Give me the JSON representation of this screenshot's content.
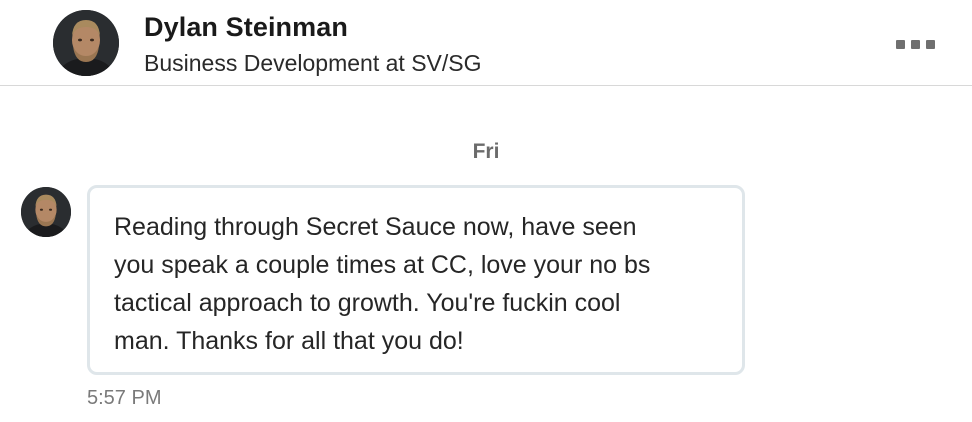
{
  "conversation": {
    "contact": {
      "name": "Dylan Steinman",
      "headline": "Business Development at SV/SG"
    },
    "more_menu_icon": "more-horizontal-icon",
    "day_label": "Fri",
    "messages": [
      {
        "lines": [
          "Reading through Secret Sauce now, have seen",
          "you speak a couple times at CC, love your no bs",
          "tactical approach to growth. You're fuckin cool",
          "man. Thanks for all that you do!"
        ],
        "time": "5:57 PM"
      }
    ]
  },
  "colors": {
    "bubble_border": "#dfe6ea",
    "divider": "#d8d8d8",
    "muted_text": "#6b6b6b"
  }
}
